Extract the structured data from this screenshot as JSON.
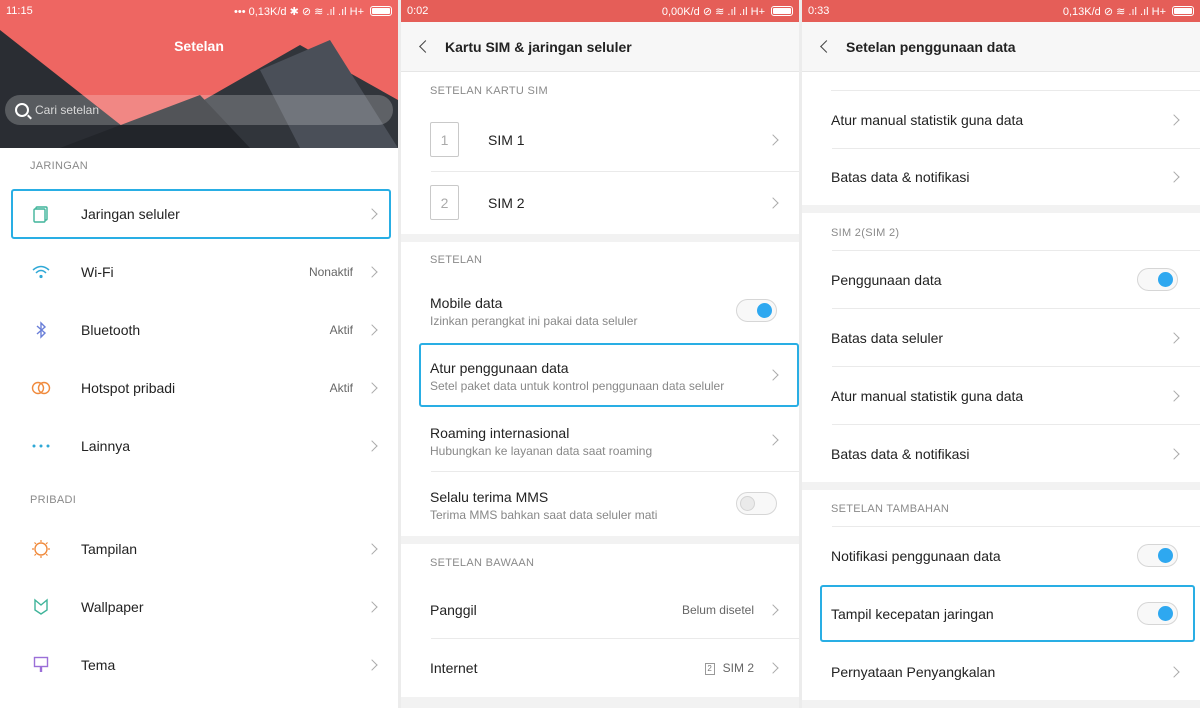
{
  "panel1": {
    "status": {
      "time": "11:15",
      "right": "••• 0,13K/d ✱ ⊘ ≋ .ıl .ıl H+"
    },
    "title": "Setelan",
    "search_placeholder": "Cari setelan",
    "section_network": "JARINGAN",
    "items_network": [
      {
        "label": "Jaringan seluler",
        "value": "",
        "icon": "sim-cards-icon"
      },
      {
        "label": "Wi-Fi",
        "value": "Nonaktif",
        "icon": "wifi-icon"
      },
      {
        "label": "Bluetooth",
        "value": "Aktif",
        "icon": "bluetooth-icon"
      },
      {
        "label": "Hotspot pribadi",
        "value": "Aktif",
        "icon": "hotspot-icon"
      },
      {
        "label": "Lainnya",
        "value": "",
        "icon": "more-dots-icon"
      }
    ],
    "section_personal": "PRIBADI",
    "items_personal": [
      {
        "label": "Tampilan",
        "value": "",
        "icon": "display-sun-icon"
      },
      {
        "label": "Wallpaper",
        "value": "",
        "icon": "wallpaper-icon"
      },
      {
        "label": "Tema",
        "value": "",
        "icon": "theme-brush-icon"
      }
    ]
  },
  "panel2": {
    "status": {
      "time": "0:02",
      "right": "0,00K/d ⊘ ≋ .ıl .ıl H+"
    },
    "title": "Kartu SIM & jaringan seluler",
    "section_sim": "SETELAN KARTU SIM",
    "sims": [
      {
        "num": "1",
        "label": "SIM 1"
      },
      {
        "num": "2",
        "label": "SIM 2"
      }
    ],
    "section_settings": "SETELAN",
    "mobile_data": {
      "title": "Mobile data",
      "sub": "Izinkan perangkat ini pakai data seluler",
      "on": true
    },
    "data_usage": {
      "title": "Atur penggunaan data",
      "sub": "Setel paket data untuk kontrol penggunaan data seluler"
    },
    "roaming": {
      "title": "Roaming internasional",
      "sub": "Hubungkan ke layanan data saat roaming"
    },
    "mms": {
      "title": "Selalu terima MMS",
      "sub": "Terima MMS bahkan saat data seluler mati",
      "on": false
    },
    "section_default": "SETELAN BAWAAN",
    "call": {
      "title": "Panggil",
      "value": "Belum disetel"
    },
    "internet": {
      "title": "Internet",
      "badge": "2",
      "value": "SIM 2"
    }
  },
  "panel3": {
    "status": {
      "time": "0:33",
      "right": "0,13K/d ⊘ ≋ .ıl .ıl H+"
    },
    "title": "Setelan penggunaan data",
    "top_items": [
      "Atur manual statistik guna data",
      "Batas data & notifikasi"
    ],
    "section_sim2": "SIM 2(SIM 2)",
    "sim2_usage": {
      "label": "Penggunaan data",
      "on": true
    },
    "sim2_items": [
      "Batas data seluler",
      "Atur manual statistik guna data",
      "Batas data & notifikasi"
    ],
    "section_extra": "SETELAN TAMBAHAN",
    "notif": {
      "label": "Notifikasi penggunaan data",
      "on": true
    },
    "speed": {
      "label": "Tampil kecepatan jaringan",
      "on": true
    },
    "disclaimer": "Pernyataan Penyangkalan"
  }
}
